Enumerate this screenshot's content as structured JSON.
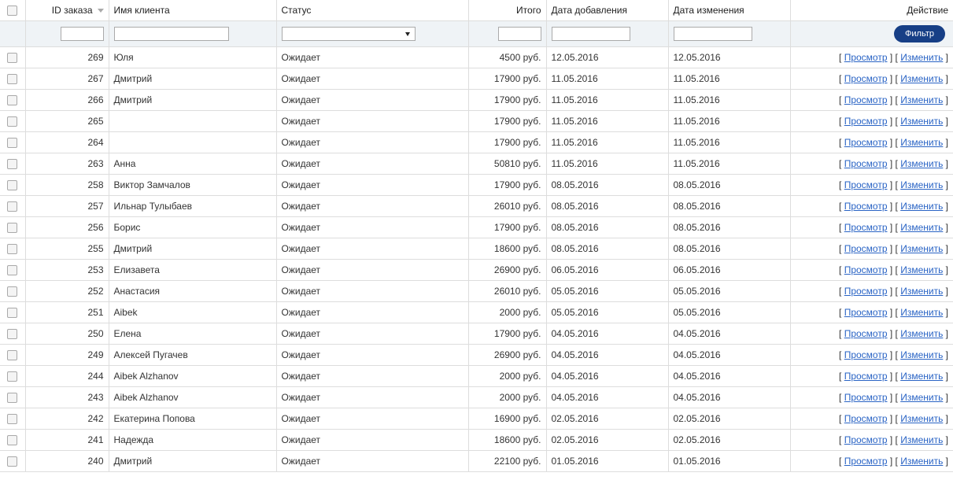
{
  "headers": {
    "id": "ID заказа",
    "name": "Имя клиента",
    "status": "Статус",
    "total": "Итого",
    "added": "Дата добавления",
    "modified": "Дата изменения",
    "action": "Действие"
  },
  "filter": {
    "button": "Фильтр"
  },
  "actions": {
    "view": "Просмотр",
    "edit": "Изменить"
  },
  "colors": {
    "accent": "#173f86",
    "link": "#2a64c5",
    "filter_row_bg": "#eff3f6"
  },
  "orders": [
    {
      "id": "269",
      "name": "Юля",
      "status": "Ожидает",
      "total": "4500 руб.",
      "added": "12.05.2016",
      "modified": "12.05.2016"
    },
    {
      "id": "267",
      "name": "Дмитрий",
      "status": "Ожидает",
      "total": "17900 руб.",
      "added": "11.05.2016",
      "modified": "11.05.2016"
    },
    {
      "id": "266",
      "name": "Дмитрий",
      "status": "Ожидает",
      "total": "17900 руб.",
      "added": "11.05.2016",
      "modified": "11.05.2016"
    },
    {
      "id": "265",
      "name": "",
      "status": "Ожидает",
      "total": "17900 руб.",
      "added": "11.05.2016",
      "modified": "11.05.2016"
    },
    {
      "id": "264",
      "name": "",
      "status": "Ожидает",
      "total": "17900 руб.",
      "added": "11.05.2016",
      "modified": "11.05.2016"
    },
    {
      "id": "263",
      "name": "Анна",
      "status": "Ожидает",
      "total": "50810 руб.",
      "added": "11.05.2016",
      "modified": "11.05.2016"
    },
    {
      "id": "258",
      "name": "Виктор Замчалов",
      "status": "Ожидает",
      "total": "17900 руб.",
      "added": "08.05.2016",
      "modified": "08.05.2016"
    },
    {
      "id": "257",
      "name": "Ильнар Тулыбаев",
      "status": "Ожидает",
      "total": "26010 руб.",
      "added": "08.05.2016",
      "modified": "08.05.2016"
    },
    {
      "id": "256",
      "name": "Борис",
      "status": "Ожидает",
      "total": "17900 руб.",
      "added": "08.05.2016",
      "modified": "08.05.2016"
    },
    {
      "id": "255",
      "name": "Дмитрий",
      "status": "Ожидает",
      "total": "18600 руб.",
      "added": "08.05.2016",
      "modified": "08.05.2016"
    },
    {
      "id": "253",
      "name": "Елизавета",
      "status": "Ожидает",
      "total": "26900 руб.",
      "added": "06.05.2016",
      "modified": "06.05.2016"
    },
    {
      "id": "252",
      "name": "Анастасия",
      "status": "Ожидает",
      "total": "26010 руб.",
      "added": "05.05.2016",
      "modified": "05.05.2016"
    },
    {
      "id": "251",
      "name": "Aibek",
      "status": "Ожидает",
      "total": "2000 руб.",
      "added": "05.05.2016",
      "modified": "05.05.2016"
    },
    {
      "id": "250",
      "name": "Елена",
      "status": "Ожидает",
      "total": "17900 руб.",
      "added": "04.05.2016",
      "modified": "04.05.2016"
    },
    {
      "id": "249",
      "name": "Алексей Пугачев",
      "status": "Ожидает",
      "total": "26900 руб.",
      "added": "04.05.2016",
      "modified": "04.05.2016"
    },
    {
      "id": "244",
      "name": "Aibek Alzhanov",
      "status": "Ожидает",
      "total": "2000 руб.",
      "added": "04.05.2016",
      "modified": "04.05.2016"
    },
    {
      "id": "243",
      "name": "Aibek Alzhanov",
      "status": "Ожидает",
      "total": "2000 руб.",
      "added": "04.05.2016",
      "modified": "04.05.2016"
    },
    {
      "id": "242",
      "name": "Екатерина Попова",
      "status": "Ожидает",
      "total": "16900 руб.",
      "added": "02.05.2016",
      "modified": "02.05.2016"
    },
    {
      "id": "241",
      "name": "Надежда",
      "status": "Ожидает",
      "total": "18600 руб.",
      "added": "02.05.2016",
      "modified": "02.05.2016"
    },
    {
      "id": "240",
      "name": "Дмитрий",
      "status": "Ожидает",
      "total": "22100 руб.",
      "added": "01.05.2016",
      "modified": "01.05.2016"
    }
  ]
}
